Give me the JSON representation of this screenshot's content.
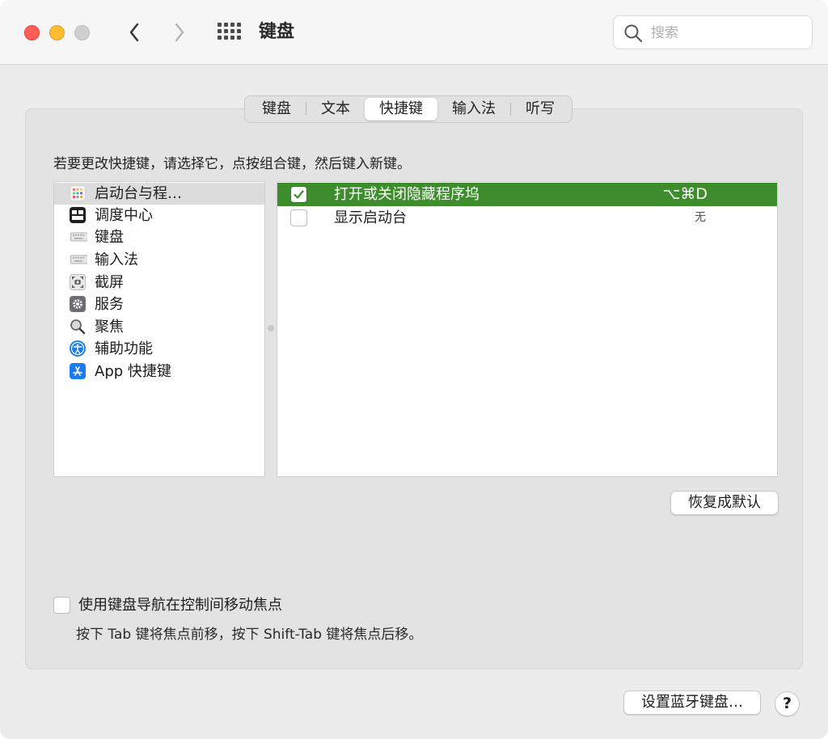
{
  "window": {
    "title": "键盘",
    "search_placeholder": "搜索"
  },
  "tabs": [
    {
      "label": "键盘",
      "active": false
    },
    {
      "label": "文本",
      "active": false
    },
    {
      "label": "快捷键",
      "active": true
    },
    {
      "label": "输入法",
      "active": false
    },
    {
      "label": "听写",
      "active": false
    }
  ],
  "instruction": "若要更改快捷键，请选择它，点按组合键，然后键入新键。",
  "categories": [
    {
      "label": "启动台与程…",
      "icon": "launchpad-icon",
      "selected": true
    },
    {
      "label": "调度中心",
      "icon": "mission-control-icon",
      "selected": false
    },
    {
      "label": "键盘",
      "icon": "keyboard-icon",
      "selected": false
    },
    {
      "label": "输入法",
      "icon": "input-method-icon",
      "selected": false
    },
    {
      "label": "截屏",
      "icon": "screenshot-icon",
      "selected": false
    },
    {
      "label": "服务",
      "icon": "services-gear-icon",
      "selected": false
    },
    {
      "label": "聚焦",
      "icon": "spotlight-icon",
      "selected": false
    },
    {
      "label": "辅助功能",
      "icon": "accessibility-icon",
      "selected": false
    },
    {
      "label": "App 快捷键",
      "icon": "app-store-icon",
      "selected": false
    }
  ],
  "shortcuts": [
    {
      "name": "打开或关闭隐藏程序坞",
      "key": "⌥⌘D",
      "checked": true,
      "selected": true
    },
    {
      "name": "显示启动台",
      "key": "无",
      "checked": false,
      "selected": false
    }
  ],
  "buttons": {
    "restore_defaults": "恢复成默认",
    "setup_bluetooth": "设置蓝牙键盘…",
    "help": "?"
  },
  "keyboard_navigation": {
    "label": "使用键盘导航在控制间移动焦点",
    "hint": "按下 Tab 键将焦点前移，按下 Shift-Tab 键将焦点后移。",
    "checked": false
  },
  "colors": {
    "selection_green": "#3d8d2c",
    "close": "#ff5f57",
    "minimize": "#febc2e"
  }
}
